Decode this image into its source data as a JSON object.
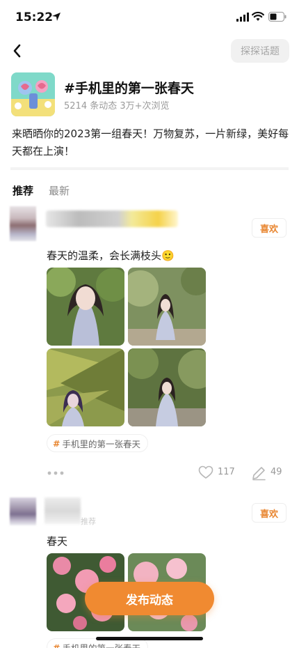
{
  "status_bar": {
    "time": "15:22"
  },
  "nav": {
    "explore_label": "探探话题"
  },
  "topic": {
    "title": "#手机里的第一张春天",
    "stats": "5214 条动态  3万+次浏览",
    "description": "来晒晒你的2023第一组春天！万物复苏，一片新绿，美好每天都在上演！"
  },
  "tabs": [
    {
      "label": "推荐"
    },
    {
      "label": "最新"
    }
  ],
  "posts": [
    {
      "like_label": "喜欢",
      "text": "春天的温柔，会长满枝头🙂",
      "tag": "手机里的第一张春天",
      "hash": "#",
      "heart_count": "117",
      "comment_count": "49"
    },
    {
      "like_label": "喜欢",
      "sub_label": "推荐",
      "text": "春天",
      "tag": "手机里的第一张春天",
      "hash": "#"
    }
  ],
  "publish_label": "发布动态",
  "colors": {
    "accent": "#f08a31",
    "like_text": "#e8852f"
  }
}
